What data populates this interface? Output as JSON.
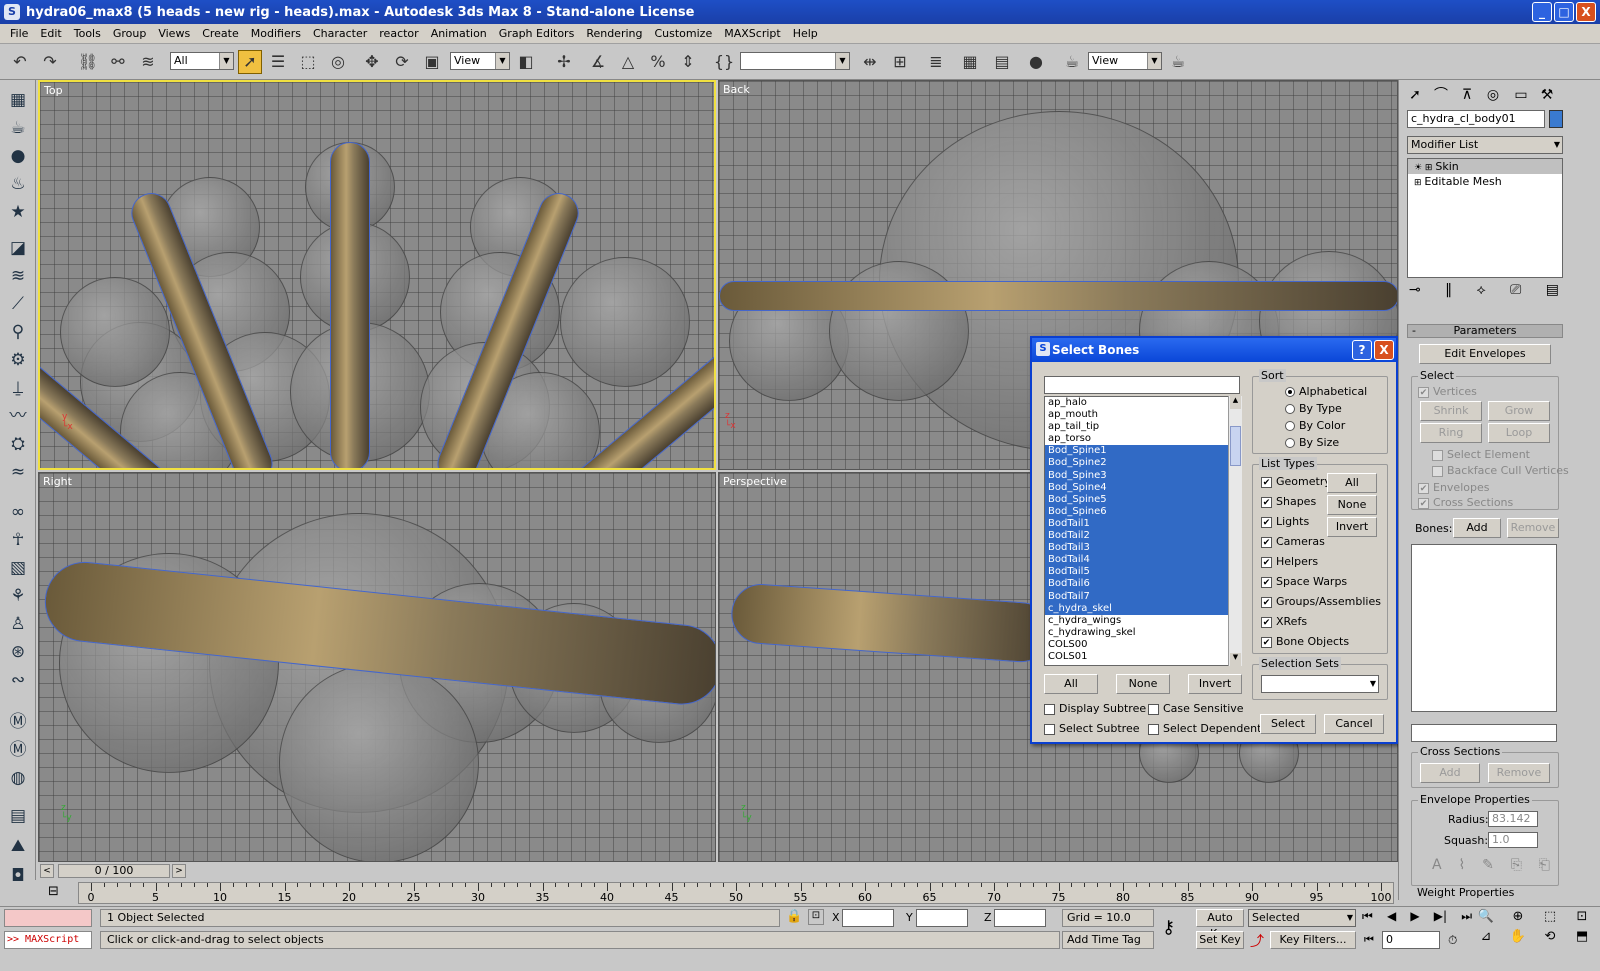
{
  "window": {
    "title": "hydra06_max8 (5 heads - new rig - heads).max - Autodesk 3ds Max 8  - Stand-alone License",
    "min": "_",
    "max": "□",
    "close": "X"
  },
  "menu": [
    "File",
    "Edit",
    "Tools",
    "Group",
    "Views",
    "Create",
    "Modifiers",
    "Character",
    "reactor",
    "Animation",
    "Graph Editors",
    "Rendering",
    "Customize",
    "MAXScript",
    "Help"
  ],
  "toolbar": {
    "selection_filter": "All",
    "ref_coord": "View",
    "named_sel": "",
    "render_view": "View"
  },
  "viewports": {
    "top": "Top",
    "back": "Back",
    "right": "Right",
    "perspective": "Perspective"
  },
  "cmd_panel": {
    "object_name": "c_hydra_cl_body01",
    "modifier_list": "Modifier List",
    "stack": [
      "Skin",
      "Editable Mesh"
    ],
    "parameters_title": "Parameters",
    "edit_envelopes": "Edit Envelopes",
    "select_group": "Select",
    "vertices": "Vertices",
    "shrink": "Shrink",
    "grow": "Grow",
    "ring": "Ring",
    "loop": "Loop",
    "select_element": "Select Element",
    "backface_cull": "Backface Cull Vertices",
    "envelopes": "Envelopes",
    "cross_sections": "Cross Sections",
    "bones_label": "Bones:",
    "add": "Add",
    "remove": "Remove",
    "cs_group": "Cross Sections",
    "cs_add": "Add",
    "cs_remove": "Remove",
    "env_props": "Envelope Properties",
    "radius_label": "Radius:",
    "radius_value": "83.142",
    "squash_label": "Squash:",
    "squash_value": "1.0",
    "weight_props": "Weight Properties"
  },
  "dialog": {
    "title": "Select Bones",
    "help": "?",
    "close": "X",
    "search": "",
    "bones": [
      "ap_halo",
      "ap_mouth",
      "ap_tail_tip",
      "ap_torso",
      "Bod_Spine1",
      "Bod_Spine2",
      "Bod_Spine3",
      "Bod_Spine4",
      "Bod_Spine5",
      "Bod_Spine6",
      "BodTail1",
      "BodTail2",
      "BodTail3",
      "BodTail4",
      "BodTail5",
      "BodTail6",
      "BodTail7",
      "c_hydra_skel",
      "c_hydra_wings",
      "c_hydrawing_skel",
      "COLS00",
      "COLS01"
    ],
    "selected_from": 4,
    "selected_to": 17,
    "sort_title": "Sort",
    "sort": [
      "Alphabetical",
      "By Type",
      "By Color",
      "By Size"
    ],
    "sort_selected": 0,
    "list_types_title": "List Types",
    "list_types": [
      "Geometry",
      "Shapes",
      "Lights",
      "Cameras",
      "Helpers",
      "Space Warps",
      "Groups/Assemblies",
      "XRefs",
      "Bone Objects"
    ],
    "lt_all": "All",
    "lt_none": "None",
    "lt_invert": "Invert",
    "selection_sets_title": "Selection Sets",
    "selection_set_value": "",
    "all": "All",
    "none": "None",
    "invert": "Invert",
    "display_subtree": "Display Subtree",
    "case_sensitive": "Case Sensitive",
    "select_subtree": "Select Subtree",
    "select_dependents": "Select Dependents",
    "select": "Select",
    "cancel": "Cancel"
  },
  "timeline": {
    "frame": "0 / 100",
    "ticks": [
      "0",
      "5",
      "10",
      "15",
      "20",
      "25",
      "30",
      "35",
      "40",
      "45",
      "50",
      "55",
      "60",
      "65",
      "70",
      "75",
      "80",
      "85",
      "90",
      "95",
      "100"
    ]
  },
  "status": {
    "maxscript": ">> MAXScript",
    "objects_selected": "1 Object Selected",
    "prompt": "Click or click-and-drag to select objects",
    "x_label": "X",
    "y_label": "Y",
    "z_label": "Z",
    "grid": "Grid = 10.0",
    "add_time_tag": "Add Time Tag",
    "auto_key": "Auto Key",
    "set_key": "Set Key",
    "key_mode": "Selected",
    "key_filters": "Key Filters...",
    "frame_field": "0"
  }
}
